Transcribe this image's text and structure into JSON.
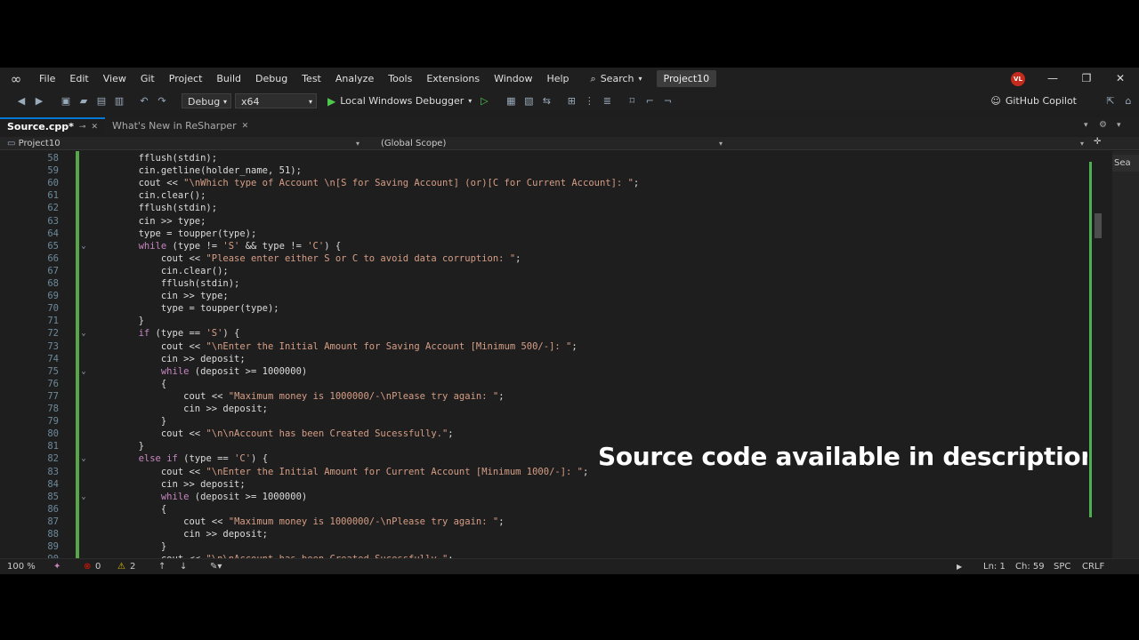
{
  "menubar": {
    "items": [
      "File",
      "Edit",
      "View",
      "Git",
      "Project",
      "Build",
      "Debug",
      "Test",
      "Analyze",
      "Tools",
      "Extensions",
      "Window",
      "Help"
    ],
    "search_label": "Search",
    "project_name": "Project10",
    "avatar_initials": "VL"
  },
  "toolbar": {
    "configuration": "Debug",
    "platform": "x64",
    "debugger_label": "Local Windows Debugger",
    "copilot_label": "GitHub Copilot"
  },
  "tabs": [
    {
      "label": "Source.cpp*",
      "active": true
    },
    {
      "label": "What's New in ReSharper",
      "active": false
    }
  ],
  "navbar": {
    "project": "Project10",
    "scope": "(Global Scope)"
  },
  "editor": {
    "lines": [
      {
        "n": "58",
        "fold": "",
        "code": "        fflush(stdin);"
      },
      {
        "n": "59",
        "fold": "",
        "code": "        cin.getline(holder_name, 51);"
      },
      {
        "n": "60",
        "fold": "",
        "code": "        cout << \"\\nWhich type of Account \\n[S for Saving Account] (or)[C for Current Account]: \";"
      },
      {
        "n": "61",
        "fold": "",
        "code": "        cin.clear();"
      },
      {
        "n": "62",
        "fold": "",
        "code": "        fflush(stdin);"
      },
      {
        "n": "63",
        "fold": "",
        "code": "        cin >> type;"
      },
      {
        "n": "64",
        "fold": "",
        "code": "        type = toupper(type);"
      },
      {
        "n": "65",
        "fold": "v",
        "code": "        while (type != 'S' && type != 'C') {"
      },
      {
        "n": "66",
        "fold": "",
        "code": "            cout << \"Please enter either S or C to avoid data corruption: \";"
      },
      {
        "n": "67",
        "fold": "",
        "code": "            cin.clear();"
      },
      {
        "n": "68",
        "fold": "",
        "code": "            fflush(stdin);"
      },
      {
        "n": "69",
        "fold": "",
        "code": "            cin >> type;"
      },
      {
        "n": "70",
        "fold": "",
        "code": "            type = toupper(type);"
      },
      {
        "n": "71",
        "fold": "",
        "code": "        }"
      },
      {
        "n": "72",
        "fold": "v",
        "code": "        if (type == 'S') {"
      },
      {
        "n": "73",
        "fold": "",
        "code": "            cout << \"\\nEnter the Initial Amount for Saving Account [Minimum 500/-]: \";"
      },
      {
        "n": "74",
        "fold": "",
        "code": "            cin >> deposit;"
      },
      {
        "n": "75",
        "fold": "v",
        "code": "            while (deposit >= 1000000)"
      },
      {
        "n": "76",
        "fold": "",
        "code": "            {"
      },
      {
        "n": "77",
        "fold": "",
        "code": "                cout << \"Maximum money is 1000000/-\\nPlease try again: \";"
      },
      {
        "n": "78",
        "fold": "",
        "code": "                cin >> deposit;"
      },
      {
        "n": "79",
        "fold": "",
        "code": "            }"
      },
      {
        "n": "80",
        "fold": "",
        "code": "            cout << \"\\n\\nAccount has been Created Sucessfully.\";"
      },
      {
        "n": "81",
        "fold": "",
        "code": "        }"
      },
      {
        "n": "82",
        "fold": "v",
        "code": "        else if (type == 'C') {"
      },
      {
        "n": "83",
        "fold": "",
        "code": "            cout << \"\\nEnter the Initial Amount for Current Account [Minimum 1000/-]: \";"
      },
      {
        "n": "84",
        "fold": "",
        "code": "            cin >> deposit;"
      },
      {
        "n": "85",
        "fold": "v",
        "code": "            while (deposit >= 1000000)"
      },
      {
        "n": "86",
        "fold": "",
        "code": "            {"
      },
      {
        "n": "87",
        "fold": "",
        "code": "                cout << \"Maximum money is 1000000/-\\nPlease try again: \";"
      },
      {
        "n": "88",
        "fold": "",
        "code": "                cin >> deposit;"
      },
      {
        "n": "89",
        "fold": "",
        "code": "            }"
      },
      {
        "n": "90",
        "fold": "",
        "code": "            cout << \"\\n\\nAccount has been Created Sucessfully.\";"
      }
    ]
  },
  "overlay": {
    "caption": "Source code available in description"
  },
  "right_panel": {
    "label": "Sea"
  },
  "statusbar": {
    "zoom": "100 %",
    "errors": "0",
    "warnings": "2",
    "line": "Ln: 1",
    "col": "Ch: 59",
    "mode": "SPC",
    "eol": "CRLF"
  },
  "colors": {
    "keyword": "#c586c0",
    "string": "#d69d85",
    "type": "#4ec9b0",
    "text": "#dcdcdc",
    "accent": "#0078d4",
    "change_bar": "#57a64a"
  }
}
